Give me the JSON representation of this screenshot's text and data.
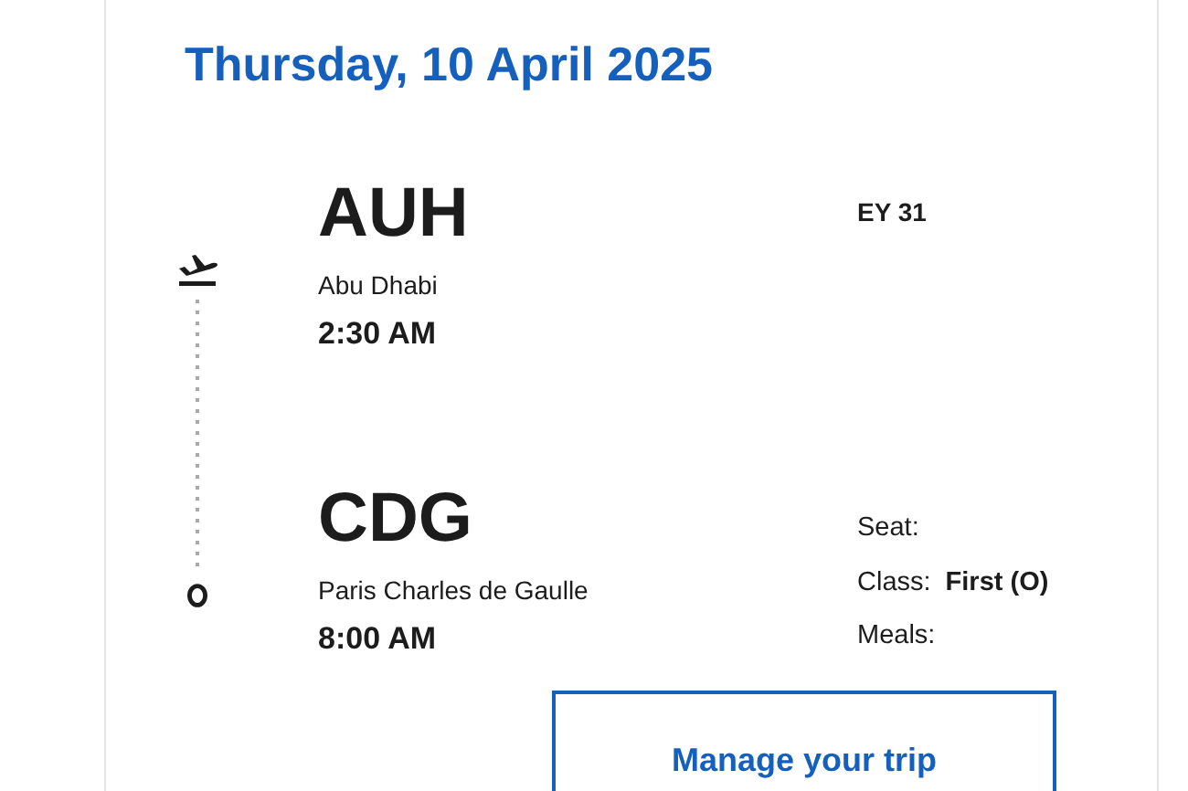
{
  "date": "Thursday, 10 April 2025",
  "segments": [
    {
      "kind": "departure",
      "code": "AUH",
      "city": "Abu Dhabi",
      "time": "2:30 AM"
    },
    {
      "kind": "arrival",
      "code": "CDG",
      "city": "Paris Charles de Gaulle",
      "time": "8:00 AM"
    }
  ],
  "flight_number": "EY 31",
  "details": [
    {
      "label": "Seat:"
    },
    {
      "label": "Class:",
      "value": "First (O)"
    },
    {
      "label": "Meals:"
    }
  ],
  "button": "Manage your trip"
}
